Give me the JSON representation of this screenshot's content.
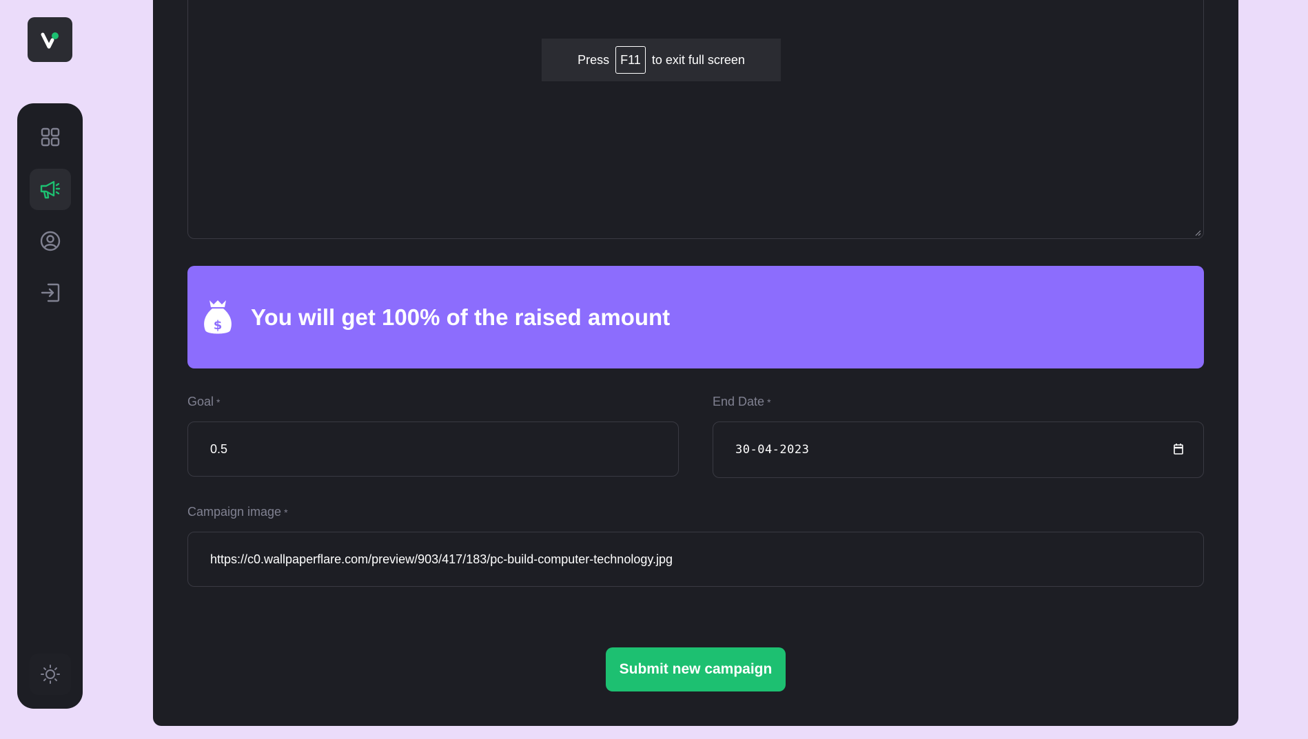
{
  "colors": {
    "page_bg": "#ebdcfa",
    "panel_bg": "#1d1e24",
    "accent_green": "#1dc071",
    "banner_purple": "#8c6dfd",
    "label_gray": "#808191"
  },
  "sidebar": {
    "logo_icon": "brand-logo-icon",
    "items": [
      {
        "icon": "dashboard-grid-icon",
        "active": false
      },
      {
        "icon": "megaphone-icon",
        "active": true
      },
      {
        "icon": "profile-icon",
        "active": false
      },
      {
        "icon": "logout-icon",
        "active": false
      }
    ],
    "theme_icon": "sun-icon"
  },
  "fullscreen_toast": {
    "prefix": "Press",
    "key": "F11",
    "suffix": "to exit full screen"
  },
  "banner": {
    "icon": "money-bag-icon",
    "title": "You will get 100% of the raised amount"
  },
  "form": {
    "goal": {
      "label": "Goal",
      "required_mark": "*",
      "value": "0.5"
    },
    "end_date": {
      "label": "End Date",
      "required_mark": "*",
      "value": "30-04-2023",
      "icon": "calendar-icon"
    },
    "campaign_image": {
      "label": "Campaign image",
      "required_mark": "*",
      "value": "https://c0.wallpaperflare.com/preview/903/417/183/pc-build-computer-technology.jpg"
    },
    "submit_label": "Submit new campaign"
  }
}
